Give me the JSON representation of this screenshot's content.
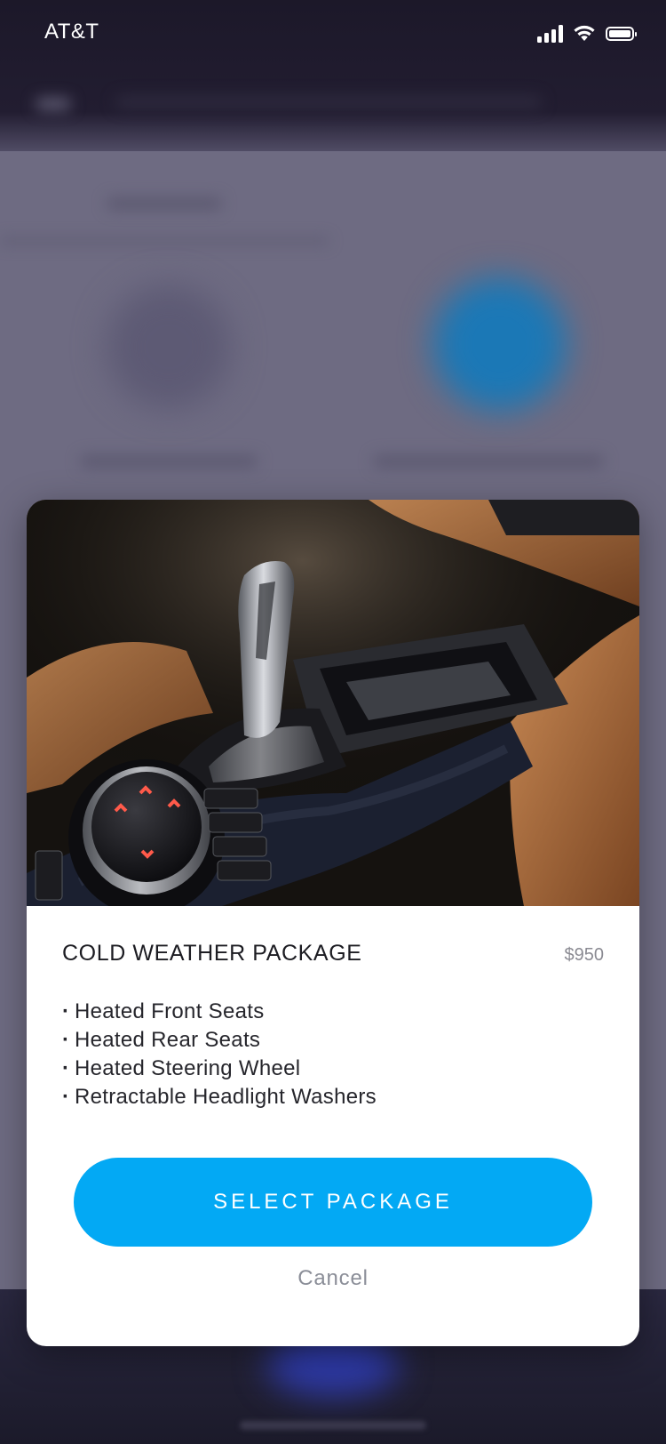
{
  "status_bar": {
    "carrier": "AT&T",
    "signal_icon": "cellular-signal-icon",
    "wifi_icon": "wifi-icon",
    "battery_icon": "battery-icon"
  },
  "modal": {
    "image_subject": "car interior gear shifter and console",
    "title": "COLD WEATHER PACKAGE",
    "price": "$950",
    "features": [
      "Heated Front Seats",
      "Heated Rear Seats",
      "Heated Steering Wheel",
      "Retractable Headlight Washers"
    ],
    "select_label": "SELECT PACKAGE",
    "cancel_label": "Cancel"
  },
  "colors": {
    "accent": "#03A9F4",
    "modal_bg": "#FFFFFF",
    "overlay": "#6E6B82",
    "title_text": "#1C1C22",
    "muted_text": "#8B8E98"
  }
}
